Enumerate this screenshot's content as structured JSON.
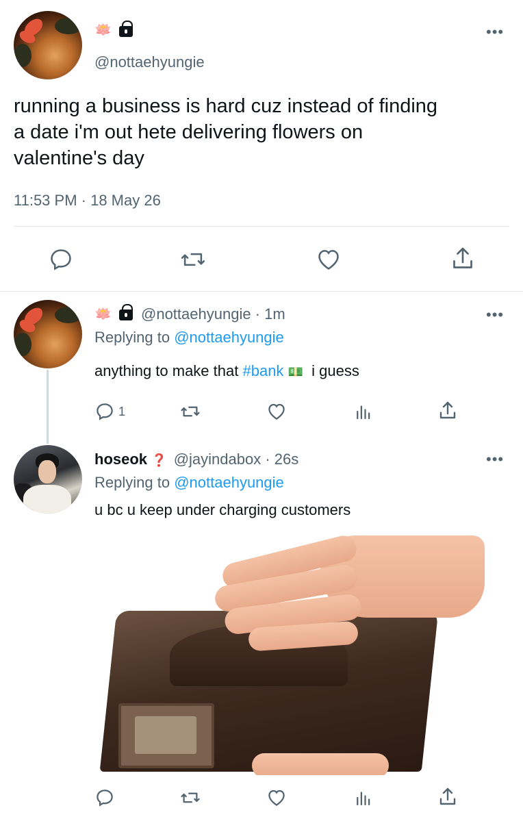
{
  "main_tweet": {
    "badge_emoji": "🪷",
    "handle": "@nottaehyungie",
    "text_lines": [
      "running a business is hard cuz instead of finding",
      "a date i'm out hete delivering flowers on",
      "valentine's day"
    ],
    "timestamp": "11:53 PM · 18 May 26",
    "more": "•••"
  },
  "reply1": {
    "badge_emoji": "🪷",
    "handle_time": "@nottaehyungie · 1m",
    "replying_prefix": "Replying to",
    "replying_to": "@nottaehyungie",
    "text_before": "anything to make that",
    "hashtag": "#bank",
    "money_emoji": "💵",
    "text_after": "i guess",
    "reply_count": "1",
    "more": "•••"
  },
  "reply2": {
    "name": "hoseok",
    "name_emoji": "❓",
    "handle_time": "@jayindabox · 26s",
    "replying_prefix": "Replying to",
    "replying_to": "@nottaehyungie",
    "text": "u bc u keep under charging customers",
    "more": "•••"
  },
  "icons": {
    "reply": "reply-icon",
    "retweet": "retweet-icon",
    "like": "heart-icon",
    "views": "analytics-icon",
    "share": "share-icon",
    "lock": "lock-icon"
  },
  "colors": {
    "text": "#0f1419",
    "secondary": "#536471",
    "link": "#1d9bf0",
    "divider": "#e6e9eb"
  }
}
